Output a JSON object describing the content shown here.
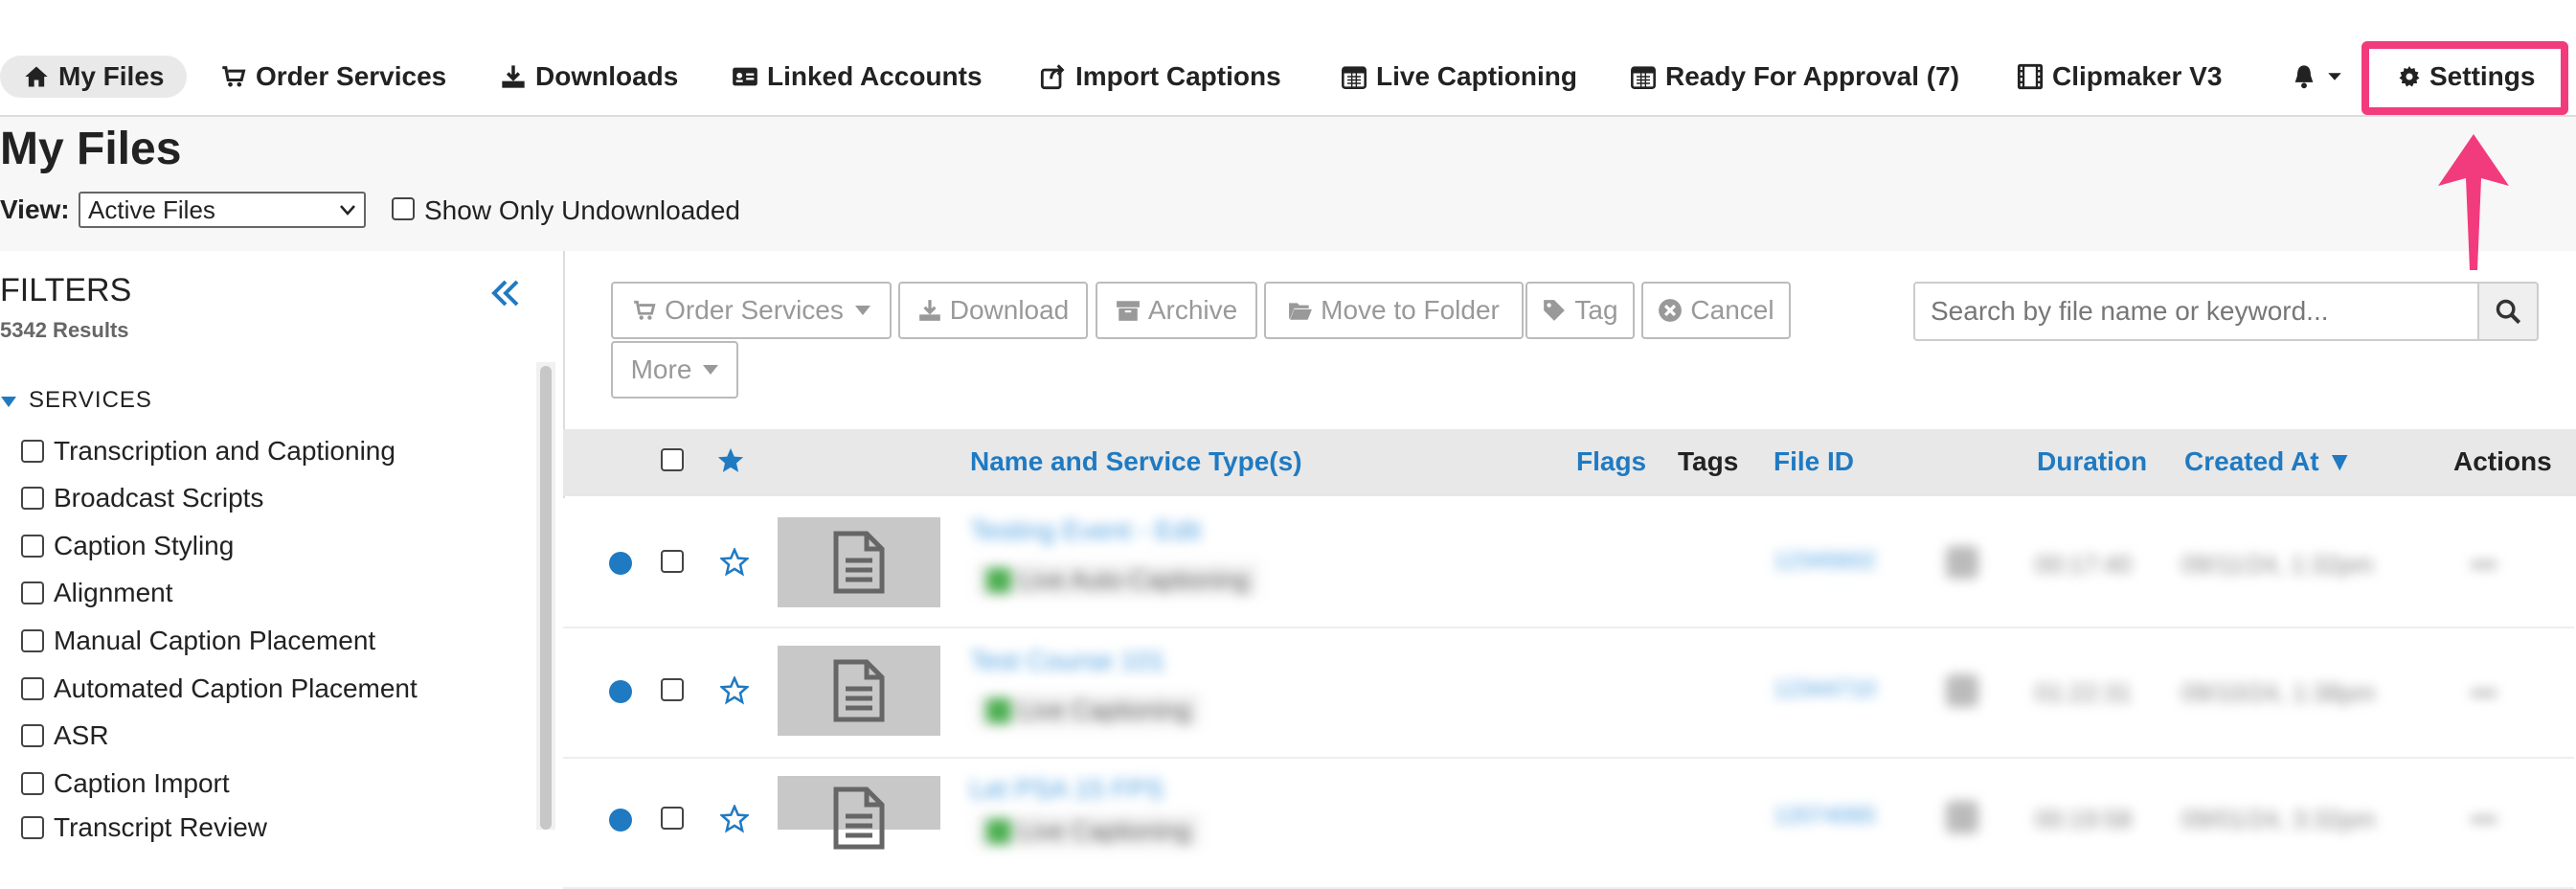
{
  "nav": {
    "items": [
      {
        "name": "nav-my-files",
        "label": "My Files",
        "icon": "home-icon"
      },
      {
        "name": "nav-order-services",
        "label": "Order Services",
        "icon": "cart-icon"
      },
      {
        "name": "nav-downloads",
        "label": "Downloads",
        "icon": "download-icon"
      },
      {
        "name": "nav-linked-accounts",
        "label": "Linked Accounts",
        "icon": "id-card-icon"
      },
      {
        "name": "nav-import-captions",
        "label": "Import Captions",
        "icon": "share-icon"
      },
      {
        "name": "nav-live-captioning",
        "label": "Live Captioning",
        "icon": "calendar-icon"
      },
      {
        "name": "nav-ready-for-approval",
        "label": "Ready For Approval (7)",
        "icon": "calendar-icon"
      },
      {
        "name": "nav-clipmaker",
        "label": "Clipmaker V3",
        "icon": "film-icon"
      }
    ],
    "settings_label": "Settings",
    "highlight_color": "#f23b7d"
  },
  "page": {
    "title": "My Files",
    "view_label": "View:",
    "view_value": "Active Files",
    "show_only_label": "Show Only Undownloaded"
  },
  "filters": {
    "title": "FILTERS",
    "count": "5342 Results",
    "services_title": "SERVICES",
    "services": [
      "Transcription and Captioning",
      "Broadcast Scripts",
      "Caption Styling",
      "Alignment",
      "Manual Caption Placement",
      "Automated Caption Placement",
      "ASR",
      "Caption Import",
      "Transcript Review"
    ]
  },
  "toolbar": {
    "order_services": "Order Services",
    "download": "Download",
    "archive": "Archive",
    "move_to_folder": "Move to Folder",
    "tag": "Tag",
    "cancel": "Cancel",
    "more": "More",
    "search_placeholder": "Search by file name or keyword..."
  },
  "table": {
    "columns": {
      "name": "Name and Service Type(s)",
      "flags": "Flags",
      "tags": "Tags",
      "file_id": "File ID",
      "duration": "Duration",
      "created_at": "Created At ▼",
      "actions": "Actions"
    },
    "rows": [
      {
        "name": "Testing Event - Edit",
        "service": "Live Auto-Captioning",
        "file_id": "12345602",
        "duration": "00:17:40",
        "created": "09/11/24, 1:32pm",
        "action": "•••"
      },
      {
        "name": "Test Course 101",
        "service": "Live Captioning",
        "file_id": "12344710",
        "duration": "01:22:31",
        "created": "09/10/24, 1:38pm",
        "action": "•••"
      },
      {
        "name": "Let PSA 15 FPS",
        "service": "Live Captioning",
        "file_id": "12074065",
        "duration": "00:19:58",
        "created": "09/01/24, 3:32pm",
        "action": "•••"
      }
    ]
  },
  "colors": {
    "accent": "#1f7ac2",
    "arrow": "#f23b7d"
  }
}
